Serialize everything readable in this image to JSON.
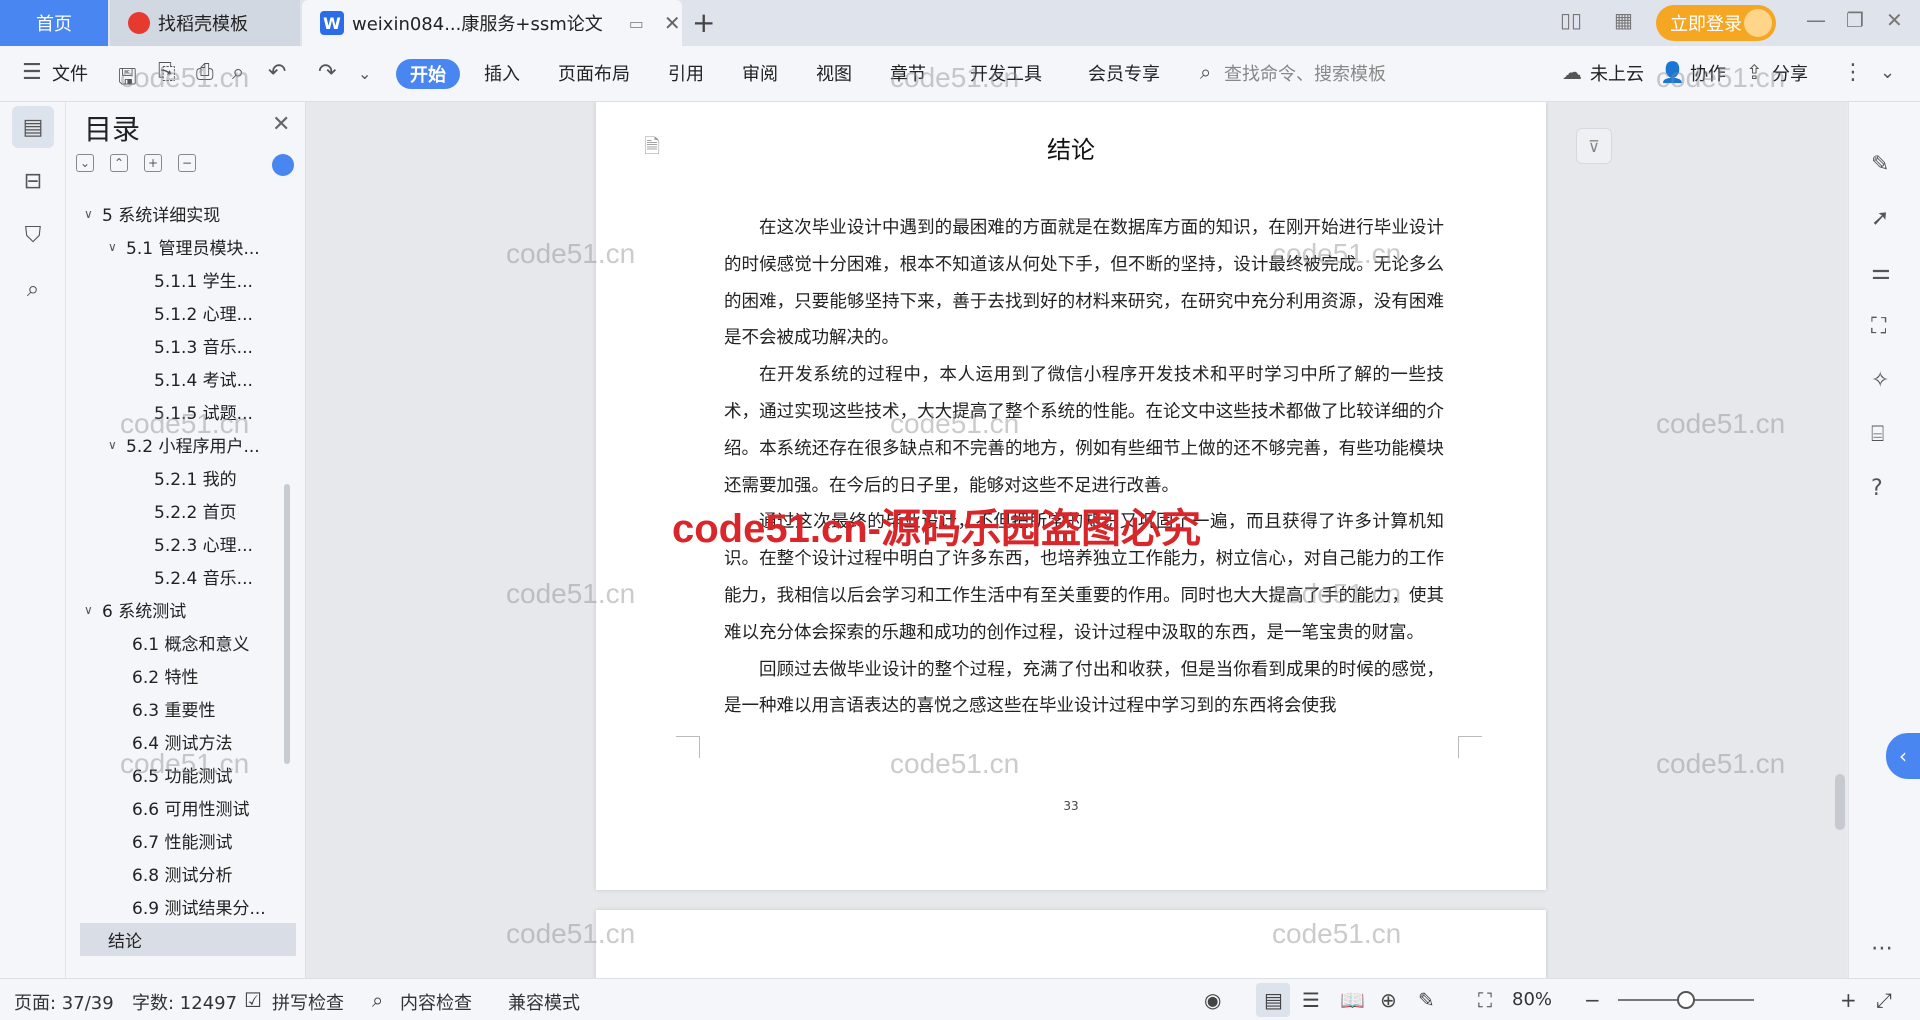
{
  "tabs": {
    "home": "首页",
    "templates": "找稻壳模板",
    "document": "weixin084...康服务+ssm论文"
  },
  "titlebar": {
    "login": "立即登录"
  },
  "ribbon": {
    "file": "文件",
    "start": "开始",
    "insert": "插入",
    "layout": "页面布局",
    "reference": "引用",
    "review": "审阅",
    "view": "视图",
    "chapter": "章节",
    "devtools": "开发工具",
    "member": "会员专享",
    "search_placeholder": "查找命令、搜索模板",
    "cloud": "未上云",
    "collab": "协作",
    "share": "分享"
  },
  "toc": {
    "title": "目录",
    "items": [
      {
        "label": "5 系统详细实现",
        "level": 1,
        "arrow": "∨"
      },
      {
        "label": "5.1 管理员模块...",
        "level": 2,
        "arrow": "∨"
      },
      {
        "label": "5.1.1 学生...",
        "level": 3
      },
      {
        "label": "5.1.2 心理...",
        "level": 3
      },
      {
        "label": "5.1.3 音乐...",
        "level": 3
      },
      {
        "label": "5.1.4 考试...",
        "level": 3
      },
      {
        "label": "5.1.5 试题...",
        "level": 3
      },
      {
        "label": "5.2 小程序用户...",
        "level": 2,
        "arrow": "∨"
      },
      {
        "label": "5.2.1 我的",
        "level": 3
      },
      {
        "label": "5.2.2 首页",
        "level": 3
      },
      {
        "label": "5.2.3 心理...",
        "level": 3
      },
      {
        "label": "5.2.4 音乐...",
        "level": 3
      },
      {
        "label": "6 系统测试",
        "level": 1,
        "arrow": "∨"
      },
      {
        "label": "6.1 概念和意义",
        "level": 2
      },
      {
        "label": "6.2 特性",
        "level": 2
      },
      {
        "label": "6.3 重要性",
        "level": 2
      },
      {
        "label": "6.4 测试方法",
        "level": 2
      },
      {
        "label": "6.5 功能测试",
        "level": 2
      },
      {
        "label": "6.6 可用性测试",
        "level": 2
      },
      {
        "label": "6.7 性能测试",
        "level": 2
      },
      {
        "label": "6.8 测试分析",
        "level": 2
      },
      {
        "label": "6.9 测试结果分...",
        "level": 2
      },
      {
        "label": "结论",
        "level": 1,
        "selected": true
      }
    ]
  },
  "page": {
    "title": "结论",
    "paragraphs": [
      "在这次毕业设计中遇到的最困难的方面就是在数据库方面的知识，在刚开始进行毕业设计的时候感觉十分困难，根本不知道该从何处下手，但不断的坚持，设计最终被完成。无论多么的困难，只要能够坚持下来，善于去找到好的材料来研究，在研究中充分利用资源，没有困难是不会被成功解决的。",
      "在开发系统的过程中，本人运用到了微信小程序开发技术和平时学习中所了解的一些技术，通过实现这些技术，大大提高了整个系统的性能。在论文中这些技术都做了比较详细的介绍。本系统还存在很多缺点和不完善的地方，例如有些细节上做的还不够完善，有些功能模块还需要加强。在今后的日子里，能够对这些不足进行改善。",
      "通过这次最终的毕业设计，不但把所学的知识又巩固了一遍，而且获得了许多计算机知识。在整个设计过程中明白了许多东西，也培养独立工作能力，树立信心，对自己能力的工作能力，我相信以后会学习和工作生活中有至关重要的作用。同时也大大提高了手的能力，使其难以充分体会探索的乐趣和成功的创作过程，设计过程中汲取的东西，是一笔宝贵的财富。",
      "回顾过去做毕业设计的整个过程，充满了付出和收获，但是当你看到成果的时候的感觉，是一种难以用言语表达的喜悦之感这些在毕业设计过程中学习到的东西将会使我"
    ],
    "page_number": "33"
  },
  "watermarks": {
    "text": "code51.cn",
    "red_text": "code51.cn-源码乐园盗图必究"
  },
  "status": {
    "page": "页面: 37/39",
    "words": "字数: 12497",
    "spell": "拼写检查",
    "content_check": "内容检查",
    "compat": "兼容模式",
    "zoom": "80%",
    "zoom_level": 0.5
  }
}
